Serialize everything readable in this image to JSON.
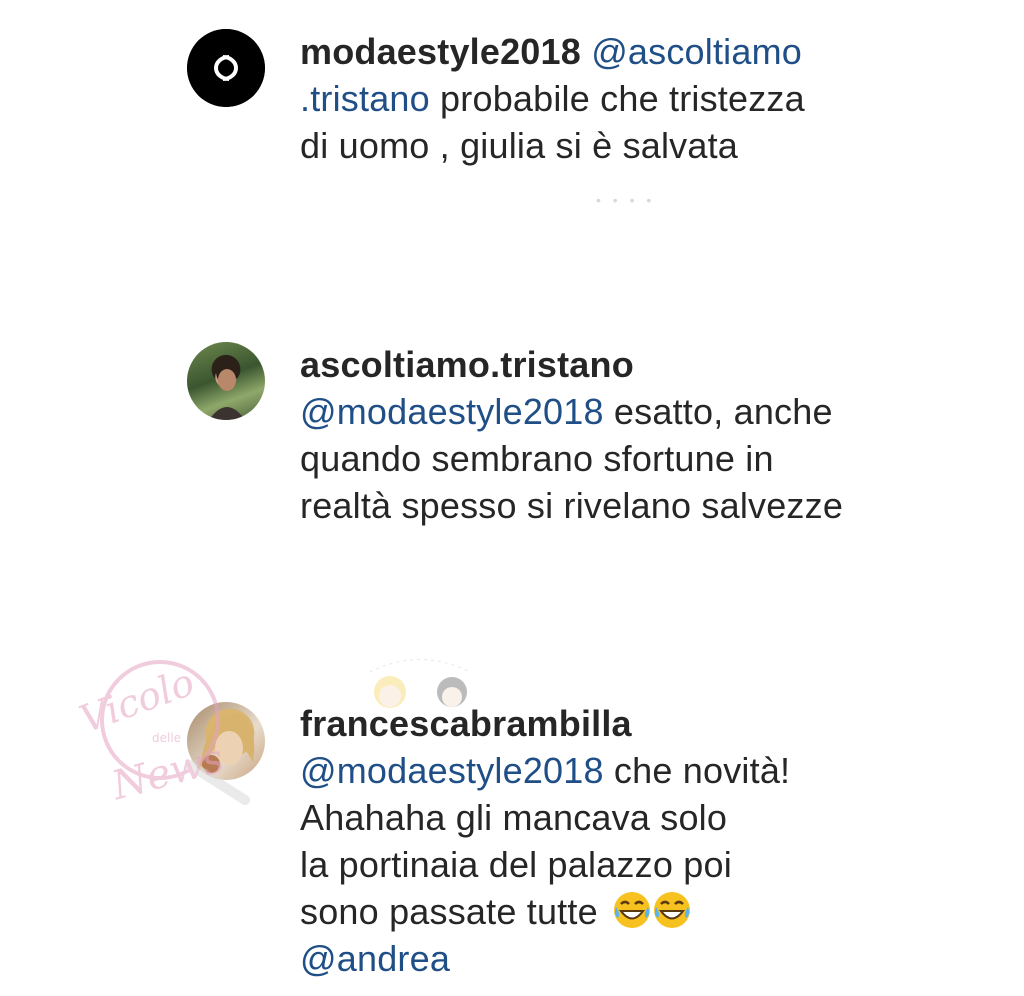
{
  "comments": [
    {
      "username": "modaestyle2018",
      "mention": "@ascoltiamo",
      "mention_cont": ".tristano",
      "text1": " probabile che tristezza",
      "text2": "di uomo , giulia si è salvata",
      "avatar_icon": "chanel-logo-icon"
    },
    {
      "username": "ascoltiamo.tristano",
      "mention": "@modaestyle2018",
      "text1": " esatto, anche",
      "text2": "quando sembrano sfortune in",
      "text3": "realtà spesso si rivelano salvezze",
      "avatar_icon": "user-photo-avatar"
    },
    {
      "username": "francescabrambilla",
      "mention": "@modaestyle2018",
      "text1": " che novità!",
      "text2": "Ahahaha gli mancava solo",
      "text3": "la portinaia del palazzo poi",
      "text4": "sono passate tutte",
      "mention2": "@andrea",
      "emoji": "face-with-tears-of-joy-emoji",
      "avatar_icon": "user-photo-avatar"
    }
  ],
  "watermark": {
    "line1": "Vicolo",
    "line2": "delle",
    "line3": "News"
  },
  "colors": {
    "text": "#262626",
    "mention": "#1f4f86",
    "background": "#ffffff",
    "watermark_pink": "#e5a3c0"
  }
}
